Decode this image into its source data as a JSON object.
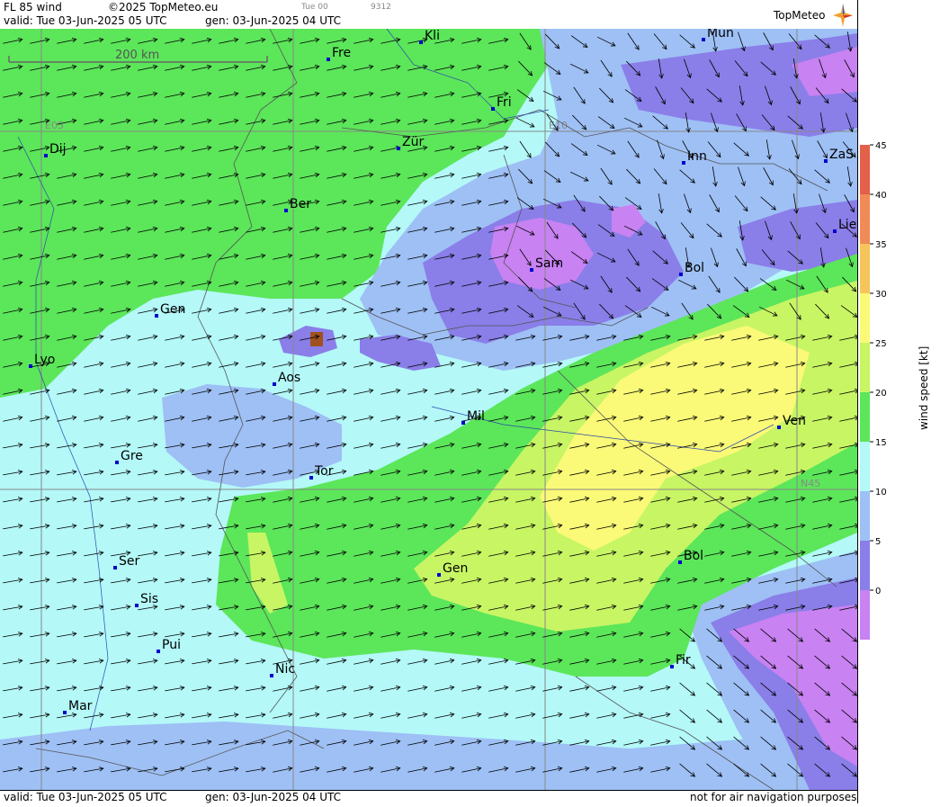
{
  "header": {
    "title": "FL 85 wind",
    "copyright": "©2025 TopMeteo.eu",
    "time_small": "Tue 00",
    "code_small": "9312",
    "valid": "valid:  Tue  03-Jun-2025  05 UTC",
    "gen": "gen: 03-Jun-2025 04 UTC",
    "logo": "TopMeteo"
  },
  "footer": {
    "valid": "valid:  Tue  03-Jun-2025  05 UTC",
    "gen": "gen: 03-Jun-2025 04 UTC",
    "disclaimer": "not for air navigation purposes"
  },
  "map": {
    "scale_label": "200 km",
    "grid_labels": [
      "E05",
      "E10",
      "N45"
    ],
    "cities": [
      "Kli",
      "Mun",
      "Fre",
      "Fri",
      "Dij",
      "Zür",
      "Inn",
      "ZaS",
      "Ber",
      "Lie",
      "Sam",
      "Bol",
      "Gen",
      "Lyo",
      "Aos",
      "Ven",
      "Mil",
      "Gre",
      "Tor",
      "Ser",
      "Gen",
      "Bol",
      "Sis",
      "Pui",
      "Nic",
      "Fir",
      "Mar"
    ]
  },
  "legend": {
    "title": "wind speed [kt]",
    "ticks": [
      "45",
      "40",
      "35",
      "30",
      "25",
      "20",
      "15",
      "10",
      "5",
      "0"
    ],
    "colors": [
      "#e3604a",
      "#f08a56",
      "#f6c45a",
      "#fafa78",
      "#c8f564",
      "#5ce65a",
      "#b4f8f8",
      "#9ec0f5",
      "#8a7ee8",
      "#c882f2"
    ]
  }
}
